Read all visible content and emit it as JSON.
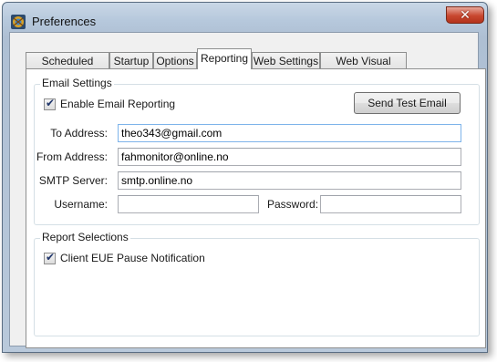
{
  "window": {
    "title": "Preferences",
    "close_symbol": "✕"
  },
  "tabs": [
    {
      "label": "Scheduled Tasks"
    },
    {
      "label": "Startup"
    },
    {
      "label": "Options"
    },
    {
      "label": "Reporting",
      "active": true
    },
    {
      "label": "Web Settings"
    },
    {
      "label": "Web Visual Styles"
    }
  ],
  "email_settings": {
    "group_title": "Email Settings",
    "enable_label": "Enable Email Reporting",
    "enable_checked": true,
    "send_test_label": "Send Test Email",
    "to_label": "To Address:",
    "to_value": "theo343@gmail.com",
    "from_label": "From Address:",
    "from_value": "fahmonitor@online.no",
    "smtp_label": "SMTP Server:",
    "smtp_value": "smtp.online.no",
    "username_label": "Username:",
    "username_value": "",
    "password_label": "Password:",
    "password_value": ""
  },
  "report_selections": {
    "group_title": "Report Selections",
    "eue_label": "Client EUE Pause Notification",
    "eue_checked": true
  },
  "icons": {
    "app": "fah-monitor-app-icon",
    "close": "close-icon",
    "check": "checkmark-icon"
  },
  "colors": {
    "close_button": "#c8472f",
    "title_bar": "#b6c8dc",
    "focus_border": "#7eb4ea"
  }
}
